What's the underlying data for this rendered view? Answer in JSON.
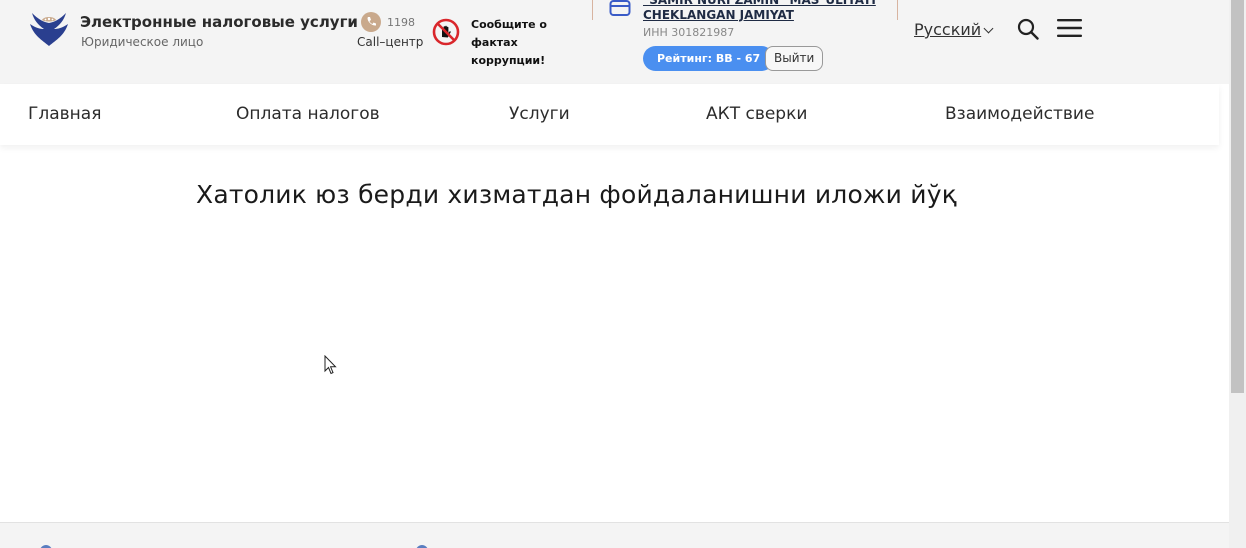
{
  "header": {
    "brand_title": "Электронные налоговые услуги",
    "brand_subtitle": "Юридическое лицо",
    "call_number": "1198",
    "call_label": "Call–центр",
    "corruption_text": "Сообщите о фактах коррупции!",
    "company_name_line1": "\"SAMIR NURI ZAMIN\" MAS`ULIYATI",
    "company_name_line2": "CHEKLANGAN JAMIYAT",
    "inn": "ИНН 301821987",
    "rating": "Рейтинг: BB - 67",
    "logout_label": "Выйти",
    "language": "Русский"
  },
  "nav": {
    "items": [
      {
        "label": "Главная"
      },
      {
        "label": "Оплата налогов"
      },
      {
        "label": "Услуги"
      },
      {
        "label": "АКТ сверки"
      },
      {
        "label": "Взаимодействие"
      }
    ]
  },
  "main": {
    "error_message": "Хатолик юз берди хизматдан фойдаланишни иложи йўқ"
  },
  "colors": {
    "header_bg": "#f4f4f4",
    "rating_badge": "#4a8ff0",
    "logo_blue": "#2a3f8f",
    "accent_tan": "#c9a98c",
    "corruption_red": "#d9262b"
  },
  "icons": {
    "logo": "eagle-logo-icon",
    "phone": "phone-icon",
    "corruption": "stop-hand-icon",
    "wallet": "wallet-icon",
    "search": "search-icon",
    "menu": "hamburger-menu-icon"
  }
}
